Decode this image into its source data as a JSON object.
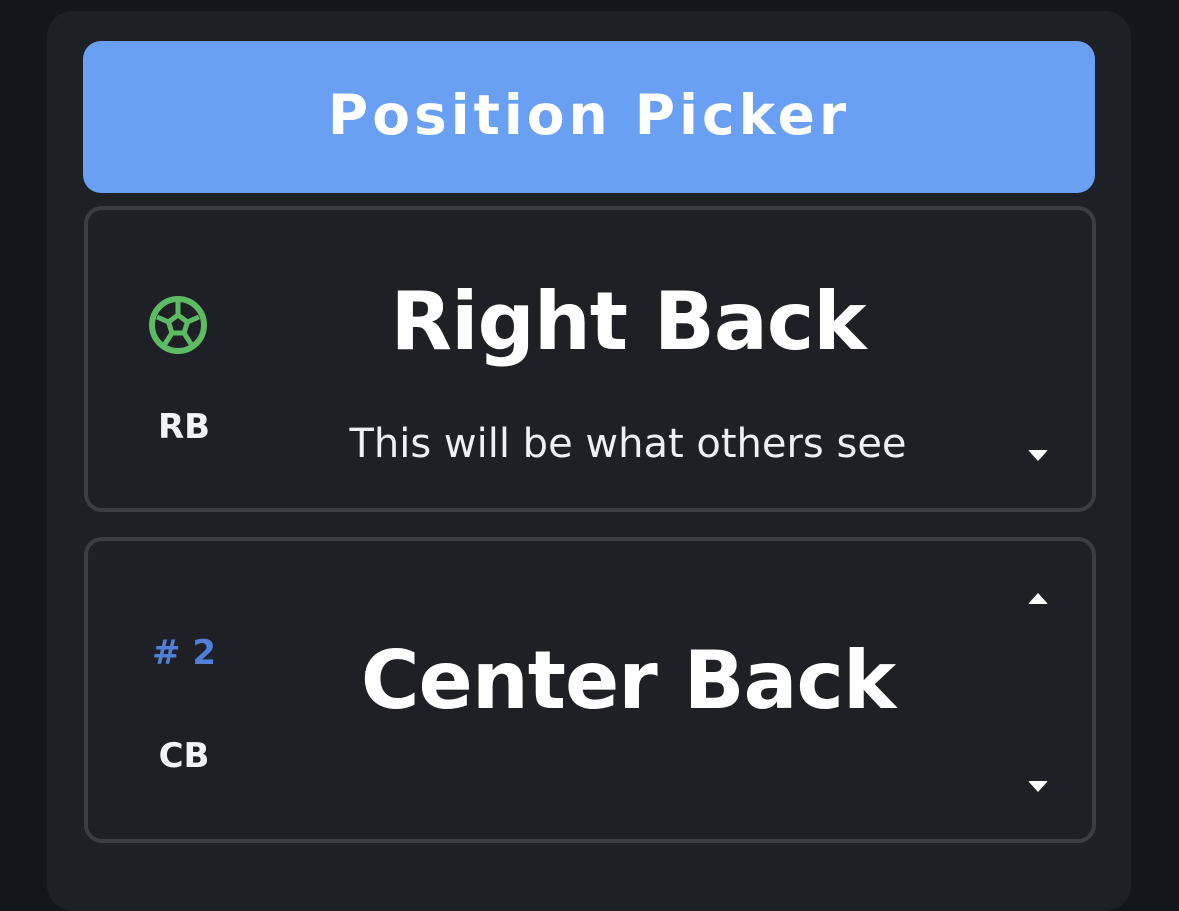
{
  "header": {
    "title": "Position Picker"
  },
  "selected_position": {
    "icon": "soccer-ball-icon",
    "icon_color": "#5dbb63",
    "abbreviation": "RB",
    "name": "Right Back",
    "hint": "This will be what others see"
  },
  "ranked_position": {
    "rank": "# 2",
    "rank_color": "#4f7fd6",
    "abbreviation": "CB",
    "name": "Center Back"
  },
  "colors": {
    "header": "#6aa0f4",
    "background": "#13161a",
    "panel": "#1d2025",
    "card_border": "#3a3d42"
  }
}
